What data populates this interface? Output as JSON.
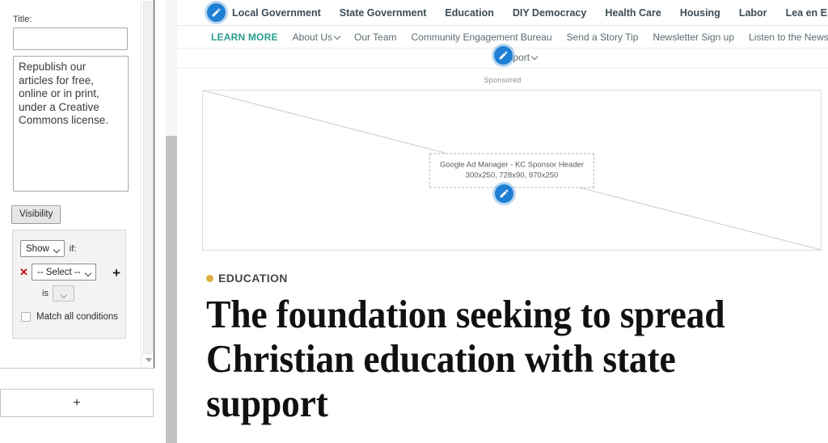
{
  "editor": {
    "title_field": {
      "label": "Title:",
      "value": "",
      "placeholder": ""
    },
    "description_field": {
      "value": "Republish our articles for free, online or in print, under a Creative Commons license."
    },
    "visibility_button": "Visibility",
    "visibility_panel": {
      "show_select": "Show",
      "if_label": "if:",
      "condition_select": "-- Select --",
      "is_label": "is",
      "operator_select": "",
      "remove_icon": "red-x-icon",
      "add_icon": "plus-icon",
      "match_all_label": "Match all conditions",
      "match_all_checked": false
    },
    "add_block_button": "+"
  },
  "site": {
    "primary_nav": [
      {
        "label": "Local Government"
      },
      {
        "label": "State Government"
      },
      {
        "label": "Education"
      },
      {
        "label": "DIY Democracy"
      },
      {
        "label": "Health Care"
      },
      {
        "label": "Housing"
      },
      {
        "label": "Labor"
      },
      {
        "label": "Lea en Español"
      }
    ],
    "secondary_nav": [
      {
        "label": "LEARN MORE",
        "accent": true
      },
      {
        "label": "About Us",
        "caret": true
      },
      {
        "label": "Our Team"
      },
      {
        "label": "Community Engagement Bureau"
      },
      {
        "label": "Send a Story Tip"
      },
      {
        "label": "Newsletter Sign up"
      },
      {
        "label": "Listen to the News"
      }
    ],
    "third_nav": {
      "label": "Support",
      "caret": true
    },
    "edit_pins": [
      {
        "name": "edit-pin-primary-nav",
        "icon": "pencil-icon"
      },
      {
        "name": "edit-pin-secondary-nav",
        "icon": "pencil-icon"
      },
      {
        "name": "edit-pin-ad-slot",
        "icon": "pencil-icon"
      }
    ],
    "ad": {
      "sponsored_label": "Sponsored",
      "slot_name": "Google Ad Manager - KC Sponsor Header",
      "slot_sizes": "300x250, 728x90, 970x250"
    },
    "article": {
      "category": "EDUCATION",
      "category_dot_color": "#dcb03e",
      "headline": "The foundation seeking to spread Christian education with state support"
    }
  },
  "colors": {
    "accent_teal": "#2a9d8f",
    "nav_text": "#3d4b54",
    "pin_blue": "#1f7fd4",
    "kicker_dot": "#dcb03e"
  }
}
